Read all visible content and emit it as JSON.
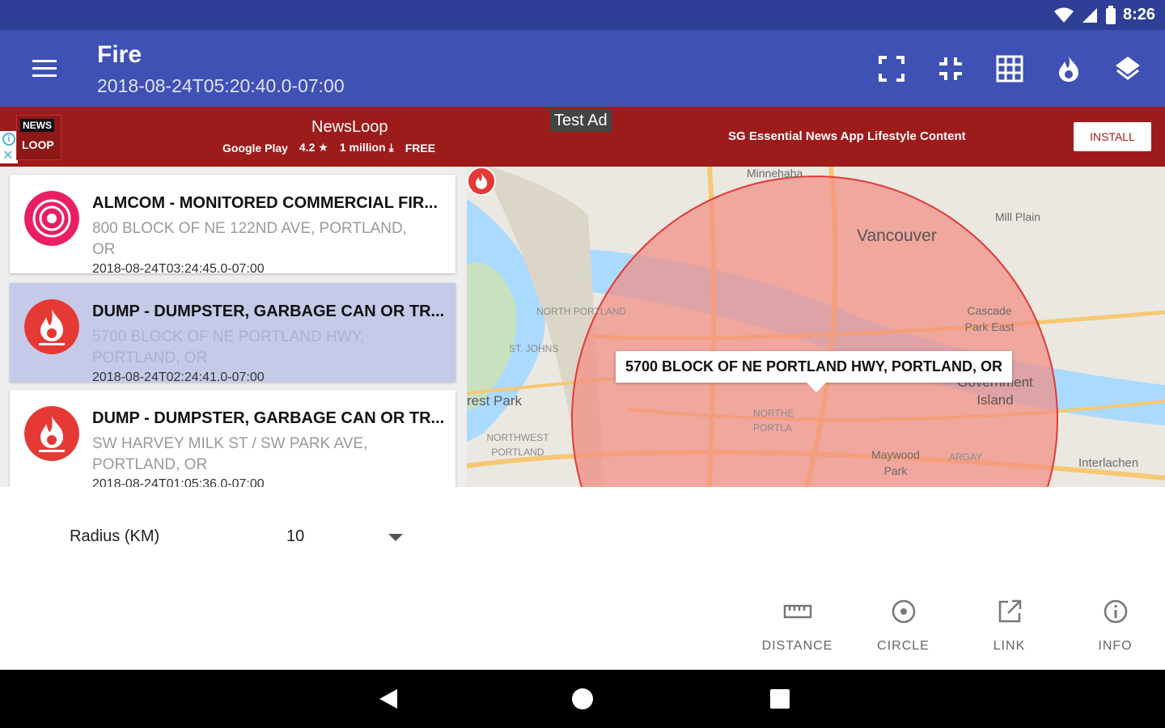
{
  "status_bar": {
    "time": "8:26"
  },
  "app_bar": {
    "title": "Fire",
    "subtitle": "2018-08-24T05:20:40.0-07:00",
    "actions": [
      "fullscreen-icon",
      "fit-bounds-icon",
      "grid-icon",
      "fire-icon",
      "layers-icon"
    ]
  },
  "ad": {
    "logo_line1": "NEWS",
    "logo_line2": "LOOP",
    "app_name": "NewsLoop",
    "store": "Google Play",
    "rating": "4.2",
    "installs": "1 million",
    "price": "FREE",
    "test_label": "Test Ad",
    "description": "SG Essential News App Lifestyle Content",
    "install_label": "INSTALL"
  },
  "incidents": [
    {
      "title": "ALMCOM - MONITORED COMMERCIAL FIR...",
      "address": "800 BLOCK OF NE 122ND AVE, PORTLAND, OR",
      "datetime": "2018-08-24T03:24:45.0-07:00",
      "icon": "alarm-icon",
      "selected": false
    },
    {
      "title": "DUMP - DUMPSTER, GARBAGE CAN OR TR...",
      "address": "5700 BLOCK OF NE PORTLAND HWY, PORTLAND, OR",
      "datetime": "2018-08-24T02:24:41.0-07:00",
      "icon": "fire-icon",
      "selected": true
    },
    {
      "title": "DUMP - DUMPSTER, GARBAGE CAN OR TR...",
      "address": "SW HARVEY MILK ST / SW PARK AVE, PORTLAND, OR",
      "datetime": "2018-08-24T01:05:36.0-07:00",
      "icon": "fire-icon",
      "selected": false
    }
  ],
  "map": {
    "popup": "5700 BLOCK OF NE PORTLAND HWY, PORTLAND, OR",
    "circle_color": "#f28b82",
    "labels": {
      "minnehaha": "Minnehaha",
      "vancouver": "Vancouver",
      "mill_plain": "Mill Plain",
      "north_portland": "NORTH PORTLAND",
      "cascade_park": "Cascade Park East",
      "st_johns": "ST. JOHNS",
      "government_island": "Government Island",
      "forest_park": "rest Park",
      "northwest_portland": "NORTHWEST PORTLAND",
      "northeast_portland": "NORTHE PORTLA",
      "maywood_park": "Maywood Park",
      "argay": "ARGAY",
      "interlachen": "Interlachen"
    }
  },
  "radius": {
    "label": "Radius (KM)",
    "value": "10"
  },
  "tools": [
    {
      "label": "DISTANCE",
      "icon": "ruler-icon"
    },
    {
      "label": "CIRCLE",
      "icon": "circle-icon"
    },
    {
      "label": "LINK",
      "icon": "link-icon"
    },
    {
      "label": "INFO",
      "icon": "info-icon"
    }
  ],
  "colors": {
    "primary": "#3f51b5",
    "primary_dark": "#2f3e96",
    "ad_bg": "#9e1b1b",
    "selected_row": "#c5cae9",
    "fire_red": "#e53935",
    "alarm_pink": "#e91e63"
  }
}
